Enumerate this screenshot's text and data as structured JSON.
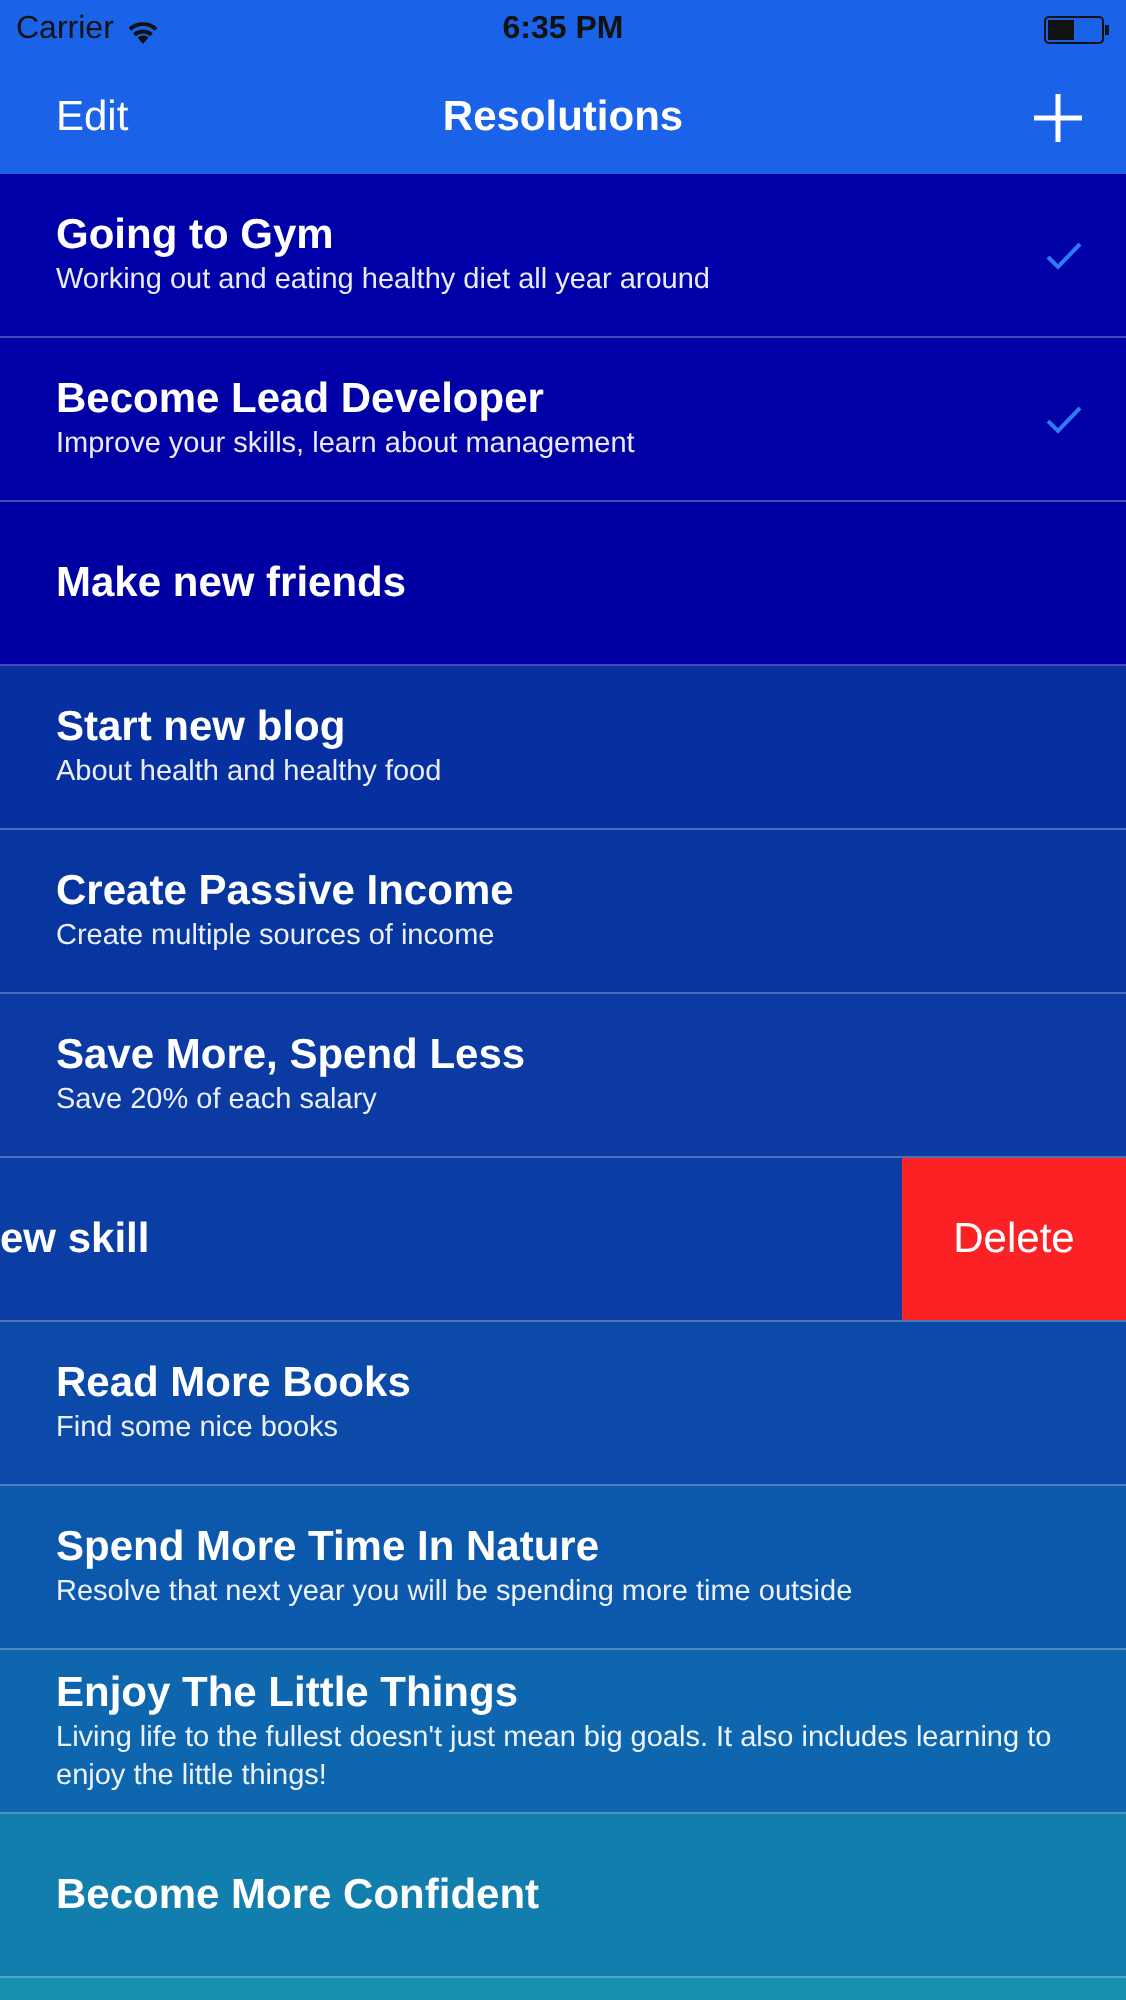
{
  "status_bar": {
    "carrier": "Carrier",
    "time": "6:35 PM"
  },
  "nav_bar": {
    "left": "Edit",
    "title": "Resolutions"
  },
  "rows": [
    {
      "title": "Going to Gym",
      "subtitle": "Working out and eating healthy diet all year around",
      "checked": true,
      "swiped": false
    },
    {
      "title": "Become Lead Developer",
      "subtitle": "Improve your skills, learn about management",
      "checked": true,
      "swiped": false
    },
    {
      "title": "Make new friends",
      "checked": false,
      "swiped": false
    },
    {
      "title": "Start new blog",
      "subtitle": "About health and healthy food",
      "checked": false,
      "swiped": false
    },
    {
      "title": "Create Passive Income",
      "subtitle": "Create multiple sources of income",
      "checked": false,
      "swiped": false
    },
    {
      "title": "Save More, Spend Less",
      "subtitle": "Save 20% of each salary",
      "checked": false,
      "swiped": false
    },
    {
      "title": "ew skill",
      "checked": false,
      "swiped": true,
      "action": "Delete"
    },
    {
      "title": "Read More Books",
      "subtitle": "Find some nice books",
      "checked": false,
      "swiped": false
    },
    {
      "title": "Spend More Time In Nature",
      "subtitle": "Resolve that next year you will be spending more time outside",
      "checked": false,
      "swiped": false
    },
    {
      "title": "Enjoy The Little Things",
      "subtitle": "Living life to the fullest doesn't just mean big goals. It also includes learning to enjoy the little things!",
      "checked": false,
      "swiped": false
    },
    {
      "title": "Become More Confident",
      "checked": false,
      "swiped": false
    }
  ]
}
